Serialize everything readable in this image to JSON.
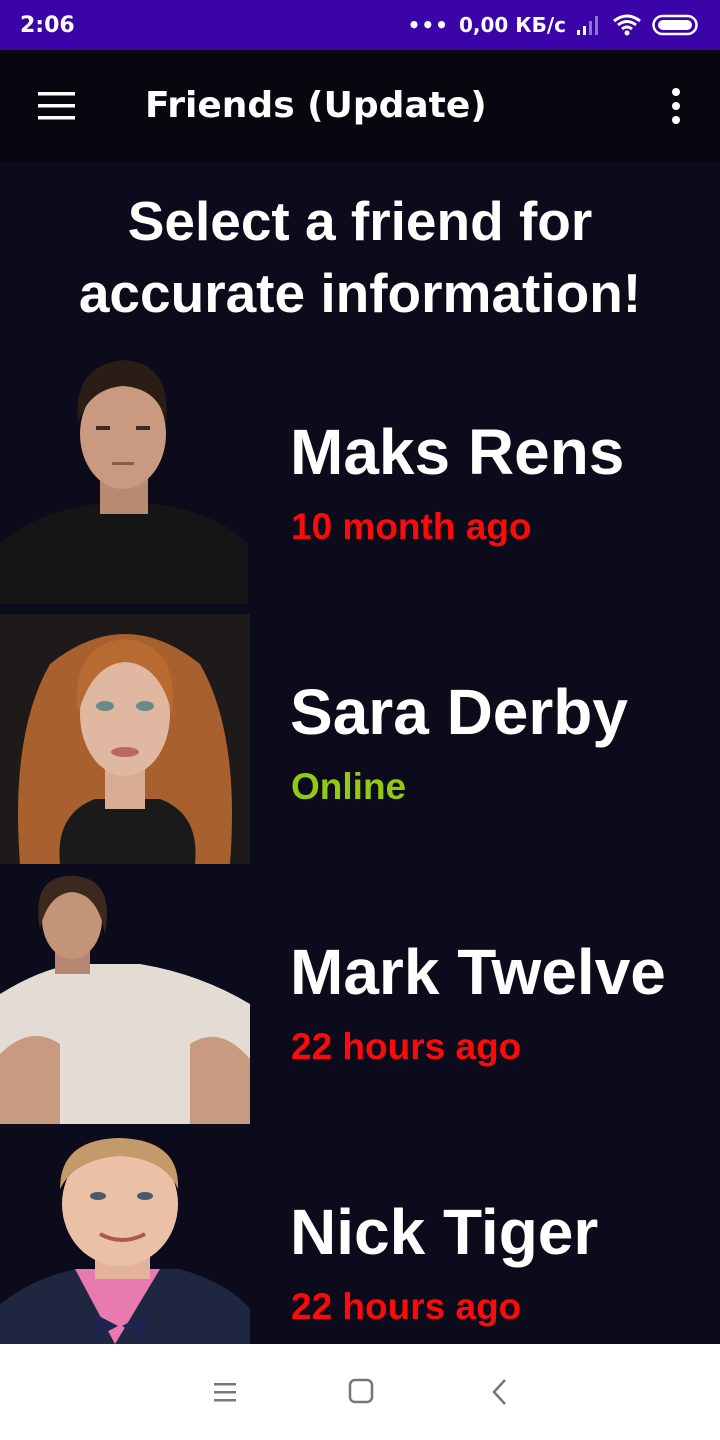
{
  "status_bar": {
    "time": "2:06",
    "more_dots": "•••",
    "network_speed": "0,00 КБ/с",
    "icons": [
      "signal-icon",
      "wifi-icon",
      "battery-icon"
    ]
  },
  "app_bar": {
    "title": "Friends (Update)",
    "menu_icon": "hamburger-menu-icon",
    "overflow_icon": "more-vert-icon"
  },
  "prompt": {
    "line1": "Select a friend for",
    "line2": "accurate information!"
  },
  "friends": [
    {
      "name": "Maks Rens",
      "status": "10 month ago",
      "status_color": "#ff0a0a"
    },
    {
      "name": "Sara Derby",
      "status": "Online",
      "status_color": "#93c90e"
    },
    {
      "name": "Mark Twelve",
      "status": "22 hours ago",
      "status_color": "#ff0a0a"
    },
    {
      "name": "Nick Tiger",
      "status": "22 hours ago",
      "status_color": "#ff0a0a"
    }
  ],
  "nav_bar": {
    "icons": [
      "recent-apps-icon",
      "home-icon",
      "back-icon"
    ]
  },
  "colors": {
    "status_bar": "#3a04a8",
    "app_bar": "#08070f",
    "background": "#0c0b1b",
    "offline": "#ff0a0a",
    "online": "#93c90e"
  }
}
